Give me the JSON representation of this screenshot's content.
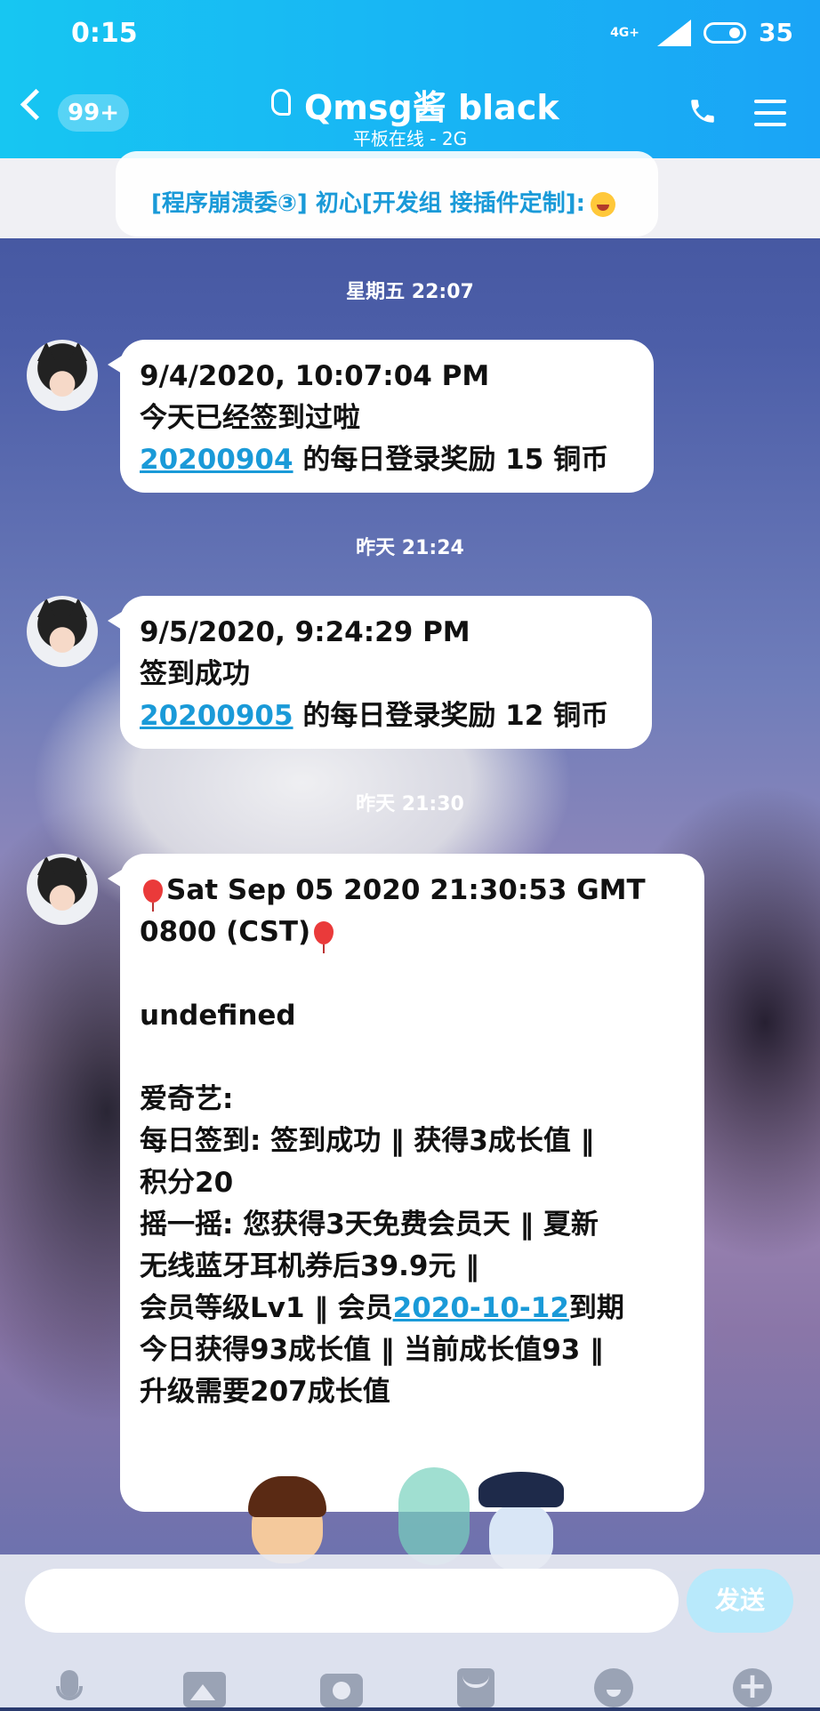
{
  "status_bar": {
    "time": "0:15",
    "network": "4G+",
    "battery": "35"
  },
  "header": {
    "back_badge": "99+",
    "title": "Qmsg酱 black",
    "subtitle": "平板在线 - 2G"
  },
  "pinned": {
    "text": "[程序崩溃委③] 初心[开发组 接插件定制]:"
  },
  "messages": [
    {
      "timestamp": "星期五 22:07",
      "line1": "9/4/2020, 10:07:04 PM",
      "line2": "今天已经签到过啦",
      "link": "20200904",
      "suffix": " 的每日登录奖励 15 铜币"
    },
    {
      "timestamp": "昨天 21:24",
      "line1": "9/5/2020, 9:24:29 PM",
      "line2": "签到成功",
      "link": "20200905",
      "suffix": " 的每日登录奖励 12 铜币"
    },
    {
      "timestamp": "昨天 21:30",
      "line1": "Sat Sep 05 2020 21:30:53 GMT",
      "line2": "0800 (CST)",
      "line3": "undefined",
      "line4": "爱奇艺:",
      "line5": "每日签到: 签到成功 ‖ 获得3成长值 ‖",
      "line6": "积分20",
      "line7": "摇一摇: 您获得3天免费会员天 ‖ 夏新",
      "line8": "无线蓝牙耳机券后39.9元 ‖",
      "line9_prefix": "会员等级Lv1 ‖ 会员",
      "line9_link": "2020-10-12",
      "line9_suffix": "到期",
      "line10": "今日获得93成长值 ‖ 当前成长值93 ‖",
      "line11": "升级需要207成长值"
    }
  ],
  "input": {
    "placeholder": "",
    "send_label": "发送"
  },
  "toolbar": [
    "mic-icon",
    "image-icon",
    "camera-icon",
    "red-packet-icon",
    "emoji-icon",
    "plus-icon"
  ],
  "colors": {
    "header": "#18b4f4",
    "link": "#1a9ad8",
    "send_button": "#b8e9fb"
  }
}
